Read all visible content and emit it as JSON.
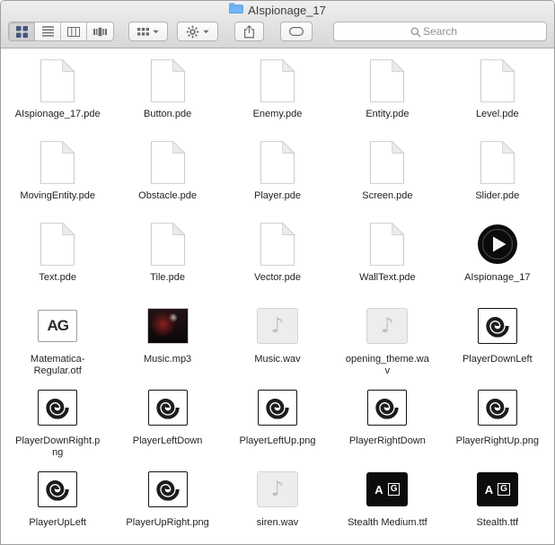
{
  "window": {
    "title": "AIspionage_17"
  },
  "toolbar": {
    "view_modes": [
      "icon-view",
      "list-view",
      "column-view",
      "coverflow-view"
    ],
    "selected_view": "icon-view",
    "search_placeholder": "Search"
  },
  "files": [
    {
      "name": "AIspionage_17.pde",
      "type": "pde"
    },
    {
      "name": "Button.pde",
      "type": "pde"
    },
    {
      "name": "Enemy.pde",
      "type": "pde"
    },
    {
      "name": "Entity.pde",
      "type": "pde"
    },
    {
      "name": "Level.pde",
      "type": "pde"
    },
    {
      "name": "MovingEntity.pde",
      "type": "pde"
    },
    {
      "name": "Obstacle.pde",
      "type": "pde"
    },
    {
      "name": "Player.pde",
      "type": "pde"
    },
    {
      "name": "Screen.pde",
      "type": "pde"
    },
    {
      "name": "Slider.pde",
      "type": "pde"
    },
    {
      "name": "Text.pde",
      "type": "pde"
    },
    {
      "name": "Tile.pde",
      "type": "pde"
    },
    {
      "name": "Vector.pde",
      "type": "pde"
    },
    {
      "name": "WallText.pde",
      "type": "pde"
    },
    {
      "name": "AIspionage_17",
      "type": "app"
    },
    {
      "name": "Matematica-Regular.otf",
      "type": "font-otf"
    },
    {
      "name": "Music.mp3",
      "type": "albumart"
    },
    {
      "name": "Music.wav",
      "type": "audio"
    },
    {
      "name": "opening_theme.wav",
      "type": "audio"
    },
    {
      "name": "PlayerDownLeft",
      "type": "sprite"
    },
    {
      "name": "PlayerDownRight.png",
      "type": "sprite"
    },
    {
      "name": "PlayerLeftDown",
      "type": "sprite"
    },
    {
      "name": "PlayerLeftUp.png",
      "type": "sprite"
    },
    {
      "name": "PlayerRightDown",
      "type": "sprite"
    },
    {
      "name": "PlayerRightUp.png",
      "type": "sprite"
    },
    {
      "name": "PlayerUpLeft",
      "type": "sprite"
    },
    {
      "name": "PlayerUpRight.png",
      "type": "sprite"
    },
    {
      "name": "siren.wav",
      "type": "audio"
    },
    {
      "name": "Stealth Medium.ttf",
      "type": "font-ttf"
    },
    {
      "name": "Stealth.ttf",
      "type": "font-ttf"
    }
  ]
}
